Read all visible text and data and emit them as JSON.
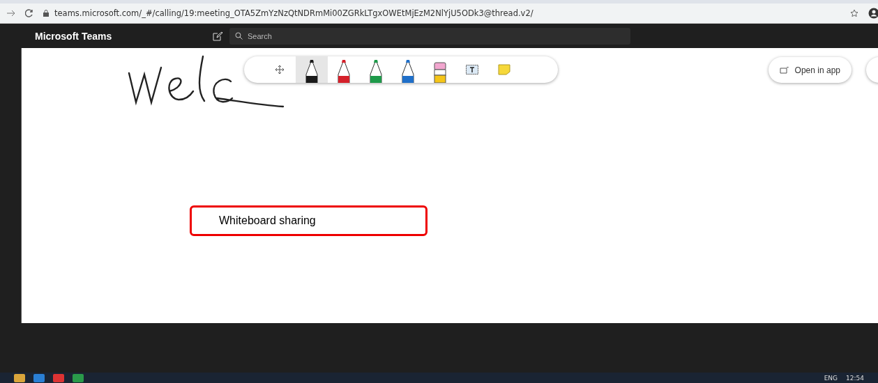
{
  "browser": {
    "url": "teams.microsoft.com/_#/calling/19:meeting_OTA5ZmYzNzQtNDRmMi00ZGRkLTgxOWEtMjEzM2NlYjU5ODk3@thread.v2/"
  },
  "header": {
    "title": "Microsoft Teams",
    "search": {
      "placeholder": "Search"
    }
  },
  "toolbar": {
    "tools": [
      {
        "kind": "move",
        "selected": false
      },
      {
        "kind": "pen",
        "color": "#1a1a1a",
        "selected": true
      },
      {
        "kind": "pen",
        "color": "#d4202a",
        "selected": false
      },
      {
        "kind": "pen",
        "color": "#1e9a4a",
        "selected": false
      },
      {
        "kind": "pen",
        "color": "#1f6fc9",
        "selected": false
      },
      {
        "kind": "eraser",
        "selected": false
      },
      {
        "kind": "text",
        "selected": false
      },
      {
        "kind": "note",
        "selected": false
      }
    ]
  },
  "open_in_app": {
    "label": "Open in app"
  },
  "callout": {
    "label": "Whiteboard sharing"
  },
  "taskbar": {
    "language": "ENG",
    "time": "12:54"
  }
}
